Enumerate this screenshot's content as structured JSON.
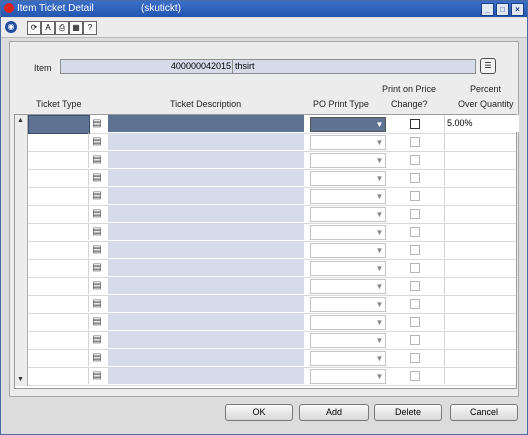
{
  "window": {
    "title": "Item Ticket Detail",
    "subtitle": "(skutickt)"
  },
  "toolbar": {
    "icons": [
      "globe-icon",
      "refresh-icon",
      "find-icon",
      "print-icon",
      "help-icon"
    ]
  },
  "item": {
    "label": "Item",
    "value": "400000042015",
    "description": "thsirt"
  },
  "grid": {
    "headers": {
      "ticket_type": "Ticket Type",
      "ticket_description": "Ticket Description",
      "po_print_type": "PO Print Type",
      "print_on_price_change_line1": "Print on Price",
      "print_on_price_change_line2": "Change?",
      "percent_over_qty_line1": "Percent",
      "percent_over_qty_line2": "Over Quantity"
    },
    "selected_row_percent": "5.00%",
    "row_count": 15
  },
  "buttons": {
    "ok": "OK",
    "add": "Add",
    "delete": "Delete",
    "cancel": "Cancel"
  }
}
